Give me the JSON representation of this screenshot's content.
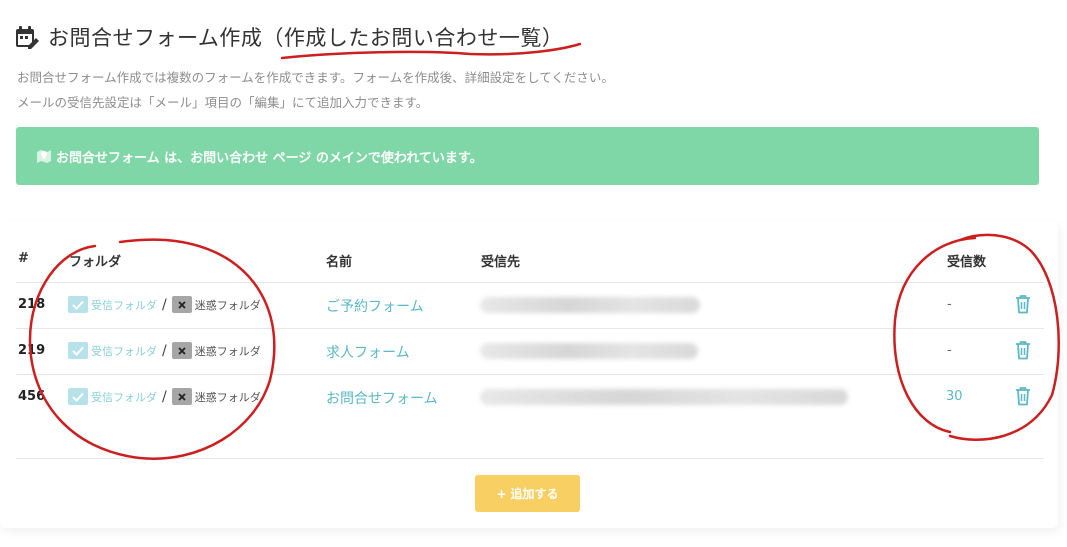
{
  "header": {
    "title": "お問合せフォーム作成（作成したお問い合わせ一覧）",
    "desc1": "お問合せフォーム作成では複数のフォームを作成できます。フォームを作成後、詳細設定をしてください。",
    "desc2": "メールの受信先設定は「メール」項目の「編集」にて追加入力できます。"
  },
  "banner": {
    "text": "お問合せフォーム は、お問い合わせ ページ のメインで使われています。"
  },
  "table": {
    "headers": {
      "id": "#",
      "folder": "フォルダ",
      "name": "名前",
      "recipient": "受信先",
      "count": "受信数"
    },
    "folder_ok_label": "受信フォルダ",
    "folder_sep": "/",
    "folder_ng_label": "迷惑フォルダ",
    "rows": [
      {
        "id": "218",
        "name": "ご予約フォーム",
        "count": "-"
      },
      {
        "id": "219",
        "name": "求人フォーム",
        "count": "-"
      },
      {
        "id": "456",
        "name": "お問合せフォーム",
        "count": "30"
      }
    ]
  },
  "add_button": {
    "plus": "+",
    "label": "追加する"
  },
  "colors": {
    "accent": "#5bb8c4",
    "banner": "#7fd6a6",
    "button": "#f8cf62",
    "annotation": "#cc1f1f"
  }
}
